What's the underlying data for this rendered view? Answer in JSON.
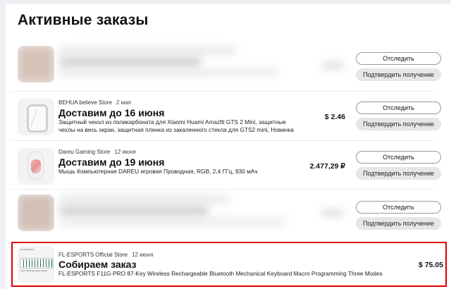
{
  "page": {
    "title": "Активные заказы"
  },
  "colors": {
    "highlight_border": "#e00000",
    "button_fill": "#e6e6e6"
  },
  "orders": [
    {
      "store": "",
      "date": "",
      "status": "",
      "description": "",
      "price": "",
      "track_label": "Отследить",
      "confirm_label": "Подтвердить получение",
      "thumb": "blurred-product-image"
    },
    {
      "store": "BEHUA believe Store",
      "date": "2 мая",
      "status": "Доставим до 16 июня",
      "description": "Защитный чехол из поликарбоната для Xiaomi Huami Amazfit GTS 2 Mini, защитные чехлы на весь экран, защитная пленка из закаленного стекла для GTS2 mini, Новинка",
      "price": "$ 2.46",
      "track_label": "Отследить",
      "confirm_label": "Подтвердить получение",
      "thumb": "watch-case-icon"
    },
    {
      "store": "Dareu Gaming Store",
      "date": "12 июня",
      "status": "Доставим до 19 июня",
      "description": "Мышь Компьютерная DAREU игровая Проводная, RGB, 2,4 ГГц, 930 мАч",
      "price": "2.477,29 ₽",
      "track_label": "Отследить",
      "confirm_label": "Подтвердить получение",
      "thumb": "mouse-icon"
    },
    {
      "store": "",
      "date": "",
      "status": "",
      "description": "",
      "price": "",
      "track_label": "Отследить",
      "confirm_label": "Подтвердить получение",
      "thumb": "blurred-product-image"
    },
    {
      "store": "FL-ESPORTS Official Store",
      "date": "12 июня",
      "status": "Собираем заказ",
      "description": "FL-ESPORTS F11G-PRO 87-Key Wireless Rechargeable Bluetooth Mechanical Keyboard Macro Programming Three Modes",
      "price": "$ 75.05",
      "thumb": "keyboard-icon"
    }
  ]
}
